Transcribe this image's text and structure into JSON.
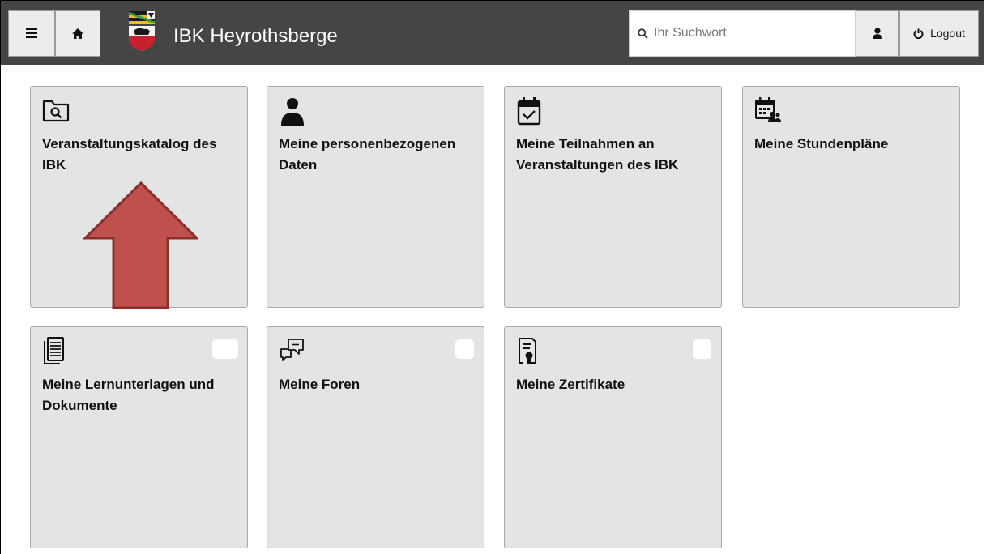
{
  "header": {
    "title": "IBK Heyrothsberge",
    "menu_icon": "hamburger-menu-icon",
    "home_icon": "home-icon",
    "logo_icon": "coat-of-arms-logo",
    "search": {
      "placeholder": "Ihr Suchwort",
      "value": "",
      "icon": "search-icon"
    },
    "user_icon": "user-icon",
    "logout_label": "Logout",
    "logout_icon": "power-icon"
  },
  "tiles": [
    {
      "label": "Veranstaltungskatalog des IBK",
      "icon": "folder-search-icon"
    },
    {
      "label": "Meine personenbezogenen Daten",
      "icon": "person-icon"
    },
    {
      "label": "Meine Teilnahmen an Veranstaltungen des IBK",
      "icon": "calendar-check-icon"
    },
    {
      "label": "Meine Stundenpläne",
      "icon": "calendar-group-icon"
    },
    {
      "label": "Meine Lernunterlagen und Dokumente",
      "icon": "documents-icon",
      "badge": ""
    },
    {
      "label": "Meine Foren",
      "icon": "chat-bubbles-icon",
      "badge": ""
    },
    {
      "label": "Meine Zertifikate",
      "icon": "certificate-icon",
      "badge": ""
    }
  ],
  "annotation": {
    "icon": "up-arrow-annotation",
    "color": "#c0504d",
    "border_color": "#8b2f2c"
  },
  "colors": {
    "topbar": "#454545",
    "tile_bg": "#e4e4e4",
    "tile_border": "#a8a8a8"
  }
}
